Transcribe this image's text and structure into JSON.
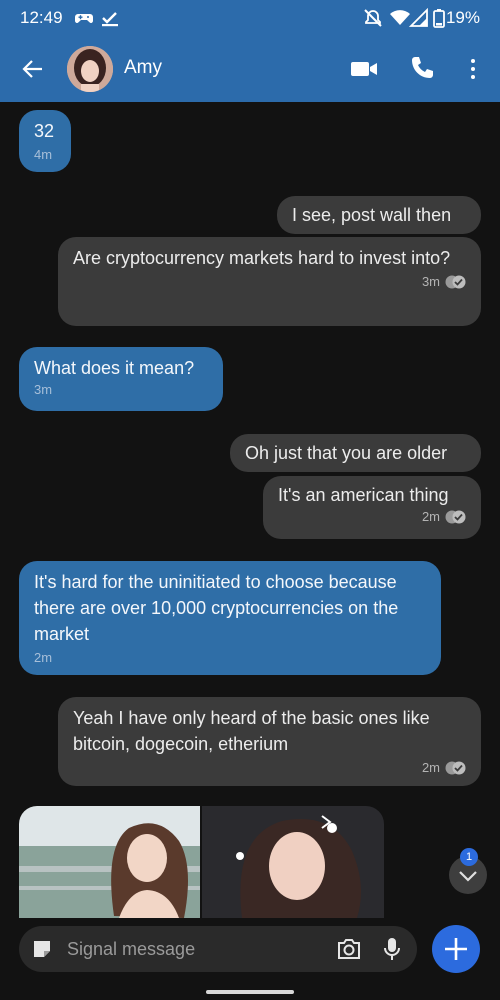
{
  "status_bar": {
    "time": "12:49",
    "battery": "19%",
    "icons": [
      "game-controller-icon",
      "download-done-icon",
      "mute-icon",
      "wifi-icon",
      "signal-icon",
      "battery-icon"
    ]
  },
  "header": {
    "contact_name": "Amy",
    "icons": [
      "back-arrow-icon",
      "video-call-icon",
      "phone-icon",
      "more-vert-icon"
    ]
  },
  "messages": [
    {
      "direction": "incoming",
      "text": "32",
      "time": "4m"
    },
    {
      "direction": "outgoing",
      "text": "I see, post wall then"
    },
    {
      "direction": "outgoing",
      "text": "Are cryptocurrency markets hard to invest into?",
      "time": "3m"
    },
    {
      "direction": "incoming",
      "text": "What does it mean?",
      "time": "3m"
    },
    {
      "direction": "outgoing",
      "text": "Oh just that you are older"
    },
    {
      "direction": "outgoing",
      "text": "It's an american thing",
      "time": "2m"
    },
    {
      "direction": "incoming",
      "text": "It's hard for the uninitiated to choose because there are over 10,000 cryptocurrencies on the market",
      "time": "2m"
    },
    {
      "direction": "outgoing",
      "text": "Yeah I have only heard of the basic ones like bitcoin, dogecoin, etherium",
      "time": "2m"
    }
  ],
  "album": {
    "photo_count": 2
  },
  "scroll_badge": "1",
  "composer": {
    "placeholder": "Signal message"
  },
  "colors": {
    "header": "#2c6bab",
    "incoming": "#2f6ea7",
    "outgoing": "#3b3b3b",
    "accent": "#2c6bde",
    "background": "#121212"
  }
}
